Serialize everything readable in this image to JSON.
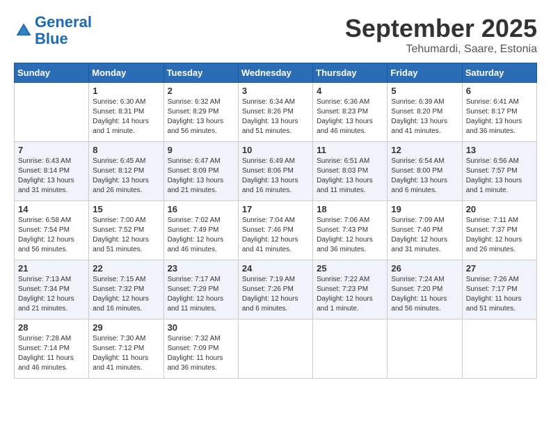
{
  "header": {
    "logo": {
      "line1": "General",
      "line2": "Blue"
    },
    "title": "September 2025",
    "location": "Tehumardi, Saare, Estonia"
  },
  "weekdays": [
    "Sunday",
    "Monday",
    "Tuesday",
    "Wednesday",
    "Thursday",
    "Friday",
    "Saturday"
  ],
  "weeks": [
    [
      {
        "day": "",
        "sunrise": "",
        "sunset": "",
        "daylight": ""
      },
      {
        "day": "1",
        "sunrise": "Sunrise: 6:30 AM",
        "sunset": "Sunset: 8:31 PM",
        "daylight": "Daylight: 14 hours and 1 minute."
      },
      {
        "day": "2",
        "sunrise": "Sunrise: 6:32 AM",
        "sunset": "Sunset: 8:29 PM",
        "daylight": "Daylight: 13 hours and 56 minutes."
      },
      {
        "day": "3",
        "sunrise": "Sunrise: 6:34 AM",
        "sunset": "Sunset: 8:26 PM",
        "daylight": "Daylight: 13 hours and 51 minutes."
      },
      {
        "day": "4",
        "sunrise": "Sunrise: 6:36 AM",
        "sunset": "Sunset: 8:23 PM",
        "daylight": "Daylight: 13 hours and 46 minutes."
      },
      {
        "day": "5",
        "sunrise": "Sunrise: 6:39 AM",
        "sunset": "Sunset: 8:20 PM",
        "daylight": "Daylight: 13 hours and 41 minutes."
      },
      {
        "day": "6",
        "sunrise": "Sunrise: 6:41 AM",
        "sunset": "Sunset: 8:17 PM",
        "daylight": "Daylight: 13 hours and 36 minutes."
      }
    ],
    [
      {
        "day": "7",
        "sunrise": "Sunrise: 6:43 AM",
        "sunset": "Sunset: 8:14 PM",
        "daylight": "Daylight: 13 hours and 31 minutes."
      },
      {
        "day": "8",
        "sunrise": "Sunrise: 6:45 AM",
        "sunset": "Sunset: 8:12 PM",
        "daylight": "Daylight: 13 hours and 26 minutes."
      },
      {
        "day": "9",
        "sunrise": "Sunrise: 6:47 AM",
        "sunset": "Sunset: 8:09 PM",
        "daylight": "Daylight: 13 hours and 21 minutes."
      },
      {
        "day": "10",
        "sunrise": "Sunrise: 6:49 AM",
        "sunset": "Sunset: 8:06 PM",
        "daylight": "Daylight: 13 hours and 16 minutes."
      },
      {
        "day": "11",
        "sunrise": "Sunrise: 6:51 AM",
        "sunset": "Sunset: 8:03 PM",
        "daylight": "Daylight: 13 hours and 11 minutes."
      },
      {
        "day": "12",
        "sunrise": "Sunrise: 6:54 AM",
        "sunset": "Sunset: 8:00 PM",
        "daylight": "Daylight: 13 hours and 6 minutes."
      },
      {
        "day": "13",
        "sunrise": "Sunrise: 6:56 AM",
        "sunset": "Sunset: 7:57 PM",
        "daylight": "Daylight: 13 hours and 1 minute."
      }
    ],
    [
      {
        "day": "14",
        "sunrise": "Sunrise: 6:58 AM",
        "sunset": "Sunset: 7:54 PM",
        "daylight": "Daylight: 12 hours and 56 minutes."
      },
      {
        "day": "15",
        "sunrise": "Sunrise: 7:00 AM",
        "sunset": "Sunset: 7:52 PM",
        "daylight": "Daylight: 12 hours and 51 minutes."
      },
      {
        "day": "16",
        "sunrise": "Sunrise: 7:02 AM",
        "sunset": "Sunset: 7:49 PM",
        "daylight": "Daylight: 12 hours and 46 minutes."
      },
      {
        "day": "17",
        "sunrise": "Sunrise: 7:04 AM",
        "sunset": "Sunset: 7:46 PM",
        "daylight": "Daylight: 12 hours and 41 minutes."
      },
      {
        "day": "18",
        "sunrise": "Sunrise: 7:06 AM",
        "sunset": "Sunset: 7:43 PM",
        "daylight": "Daylight: 12 hours and 36 minutes."
      },
      {
        "day": "19",
        "sunrise": "Sunrise: 7:09 AM",
        "sunset": "Sunset: 7:40 PM",
        "daylight": "Daylight: 12 hours and 31 minutes."
      },
      {
        "day": "20",
        "sunrise": "Sunrise: 7:11 AM",
        "sunset": "Sunset: 7:37 PM",
        "daylight": "Daylight: 12 hours and 26 minutes."
      }
    ],
    [
      {
        "day": "21",
        "sunrise": "Sunrise: 7:13 AM",
        "sunset": "Sunset: 7:34 PM",
        "daylight": "Daylight: 12 hours and 21 minutes."
      },
      {
        "day": "22",
        "sunrise": "Sunrise: 7:15 AM",
        "sunset": "Sunset: 7:32 PM",
        "daylight": "Daylight: 12 hours and 16 minutes."
      },
      {
        "day": "23",
        "sunrise": "Sunrise: 7:17 AM",
        "sunset": "Sunset: 7:29 PM",
        "daylight": "Daylight: 12 hours and 11 minutes."
      },
      {
        "day": "24",
        "sunrise": "Sunrise: 7:19 AM",
        "sunset": "Sunset: 7:26 PM",
        "daylight": "Daylight: 12 hours and 6 minutes."
      },
      {
        "day": "25",
        "sunrise": "Sunrise: 7:22 AM",
        "sunset": "Sunset: 7:23 PM",
        "daylight": "Daylight: 12 hours and 1 minute."
      },
      {
        "day": "26",
        "sunrise": "Sunrise: 7:24 AM",
        "sunset": "Sunset: 7:20 PM",
        "daylight": "Daylight: 11 hours and 56 minutes."
      },
      {
        "day": "27",
        "sunrise": "Sunrise: 7:26 AM",
        "sunset": "Sunset: 7:17 PM",
        "daylight": "Daylight: 11 hours and 51 minutes."
      }
    ],
    [
      {
        "day": "28",
        "sunrise": "Sunrise: 7:28 AM",
        "sunset": "Sunset: 7:14 PM",
        "daylight": "Daylight: 11 hours and 46 minutes."
      },
      {
        "day": "29",
        "sunrise": "Sunrise: 7:30 AM",
        "sunset": "Sunset: 7:12 PM",
        "daylight": "Daylight: 11 hours and 41 minutes."
      },
      {
        "day": "30",
        "sunrise": "Sunrise: 7:32 AM",
        "sunset": "Sunset: 7:09 PM",
        "daylight": "Daylight: 11 hours and 36 minutes."
      },
      {
        "day": "",
        "sunrise": "",
        "sunset": "",
        "daylight": ""
      },
      {
        "day": "",
        "sunrise": "",
        "sunset": "",
        "daylight": ""
      },
      {
        "day": "",
        "sunrise": "",
        "sunset": "",
        "daylight": ""
      },
      {
        "day": "",
        "sunrise": "",
        "sunset": "",
        "daylight": ""
      }
    ]
  ]
}
